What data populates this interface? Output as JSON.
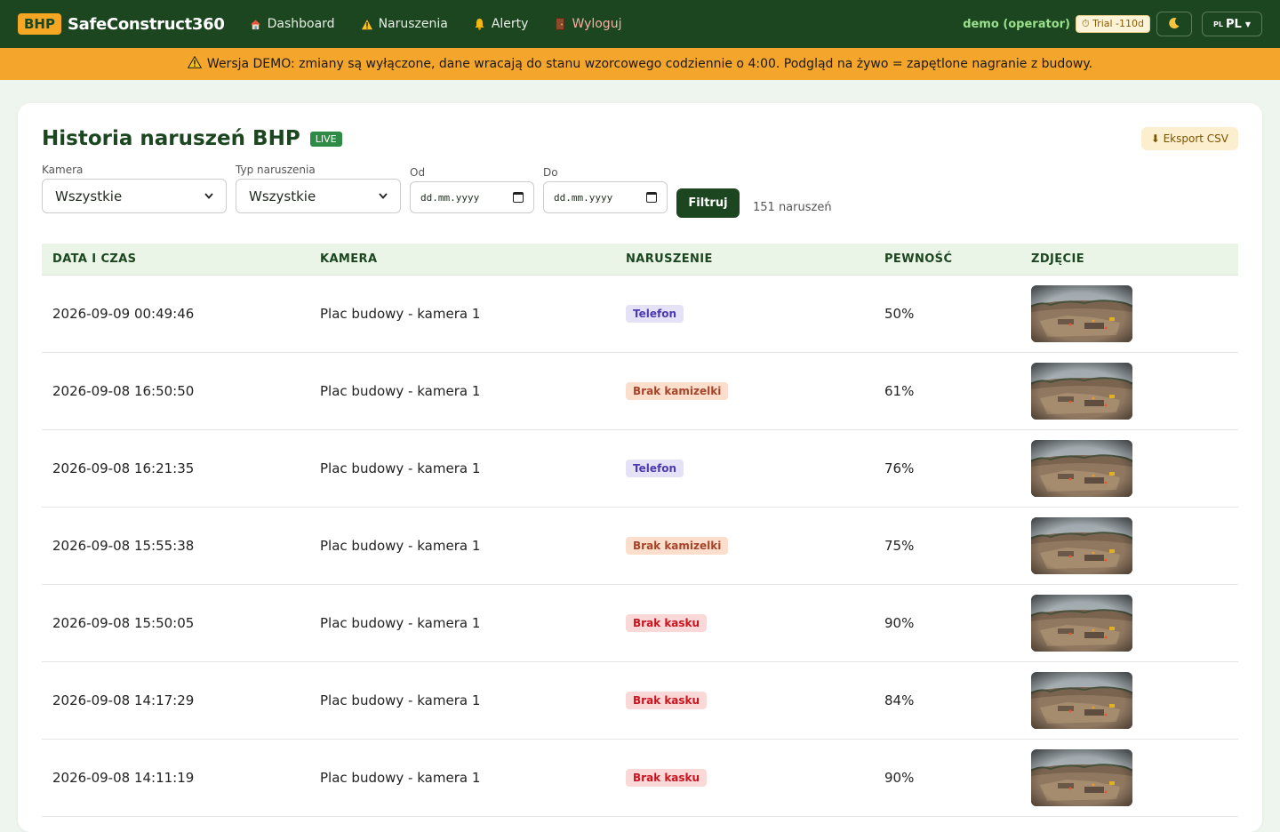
{
  "navbar": {
    "brand_badge": "BHP",
    "brand_name": "SafeConstruct360",
    "links": [
      {
        "label": "Dashboard",
        "icon": "house-icon"
      },
      {
        "label": "Naruszenia",
        "icon": "warning-icon"
      },
      {
        "label": "Alerty",
        "icon": "bell-icon"
      },
      {
        "label": "Wyloguj",
        "icon": "door-icon"
      }
    ],
    "user": "demo (operator)",
    "trial": "⏱ Trial -110d",
    "theme_icon": "moon-icon",
    "lang_flag": "PL",
    "lang_label": "PL"
  },
  "banner": {
    "text": "Wersja DEMO: zmiany są wyłączone, dane wracają do stanu wzorcowego codziennie o 4:00. Podgląd na żywo = zapętlone nagranie z budowy."
  },
  "page": {
    "title": "Historia naruszeń BHP",
    "live_badge": "LIVE",
    "export_label": "⬇ Eksport CSV"
  },
  "filters": {
    "camera_label": "Kamera",
    "camera_value": "Wszystkie",
    "type_label": "Typ naruszenia",
    "type_value": "Wszystkie",
    "from_label": "Od",
    "to_label": "Do",
    "date_placeholder": "dd.mm.yyyy",
    "filter_button": "Filtruj",
    "count": "151 naruszeń"
  },
  "table": {
    "headers": [
      "DATA I CZAS",
      "KAMERA",
      "NARUSZENIE",
      "PEWNOŚĆ",
      "ZDJĘCIE"
    ],
    "rows": [
      {
        "datetime": "2026-09-09 00:49:46",
        "camera": "Plac budowy - kamera 1",
        "violation": "Telefon",
        "kind": "phone",
        "confidence": "50%"
      },
      {
        "datetime": "2026-09-08 16:50:50",
        "camera": "Plac budowy - kamera 1",
        "violation": "Brak kamizelki",
        "kind": "vest",
        "confidence": "61%"
      },
      {
        "datetime": "2026-09-08 16:21:35",
        "camera": "Plac budowy - kamera 1",
        "violation": "Telefon",
        "kind": "phone",
        "confidence": "76%"
      },
      {
        "datetime": "2026-09-08 15:55:38",
        "camera": "Plac budowy - kamera 1",
        "violation": "Brak kamizelki",
        "kind": "vest",
        "confidence": "75%"
      },
      {
        "datetime": "2026-09-08 15:50:05",
        "camera": "Plac budowy - kamera 1",
        "violation": "Brak kasku",
        "kind": "helmet",
        "confidence": "90%"
      },
      {
        "datetime": "2026-09-08 14:17:29",
        "camera": "Plac budowy - kamera 1",
        "violation": "Brak kasku",
        "kind": "helmet",
        "confidence": "84%"
      },
      {
        "datetime": "2026-09-08 14:11:19",
        "camera": "Plac budowy - kamera 1",
        "violation": "Brak kasku",
        "kind": "helmet",
        "confidence": "90%"
      }
    ]
  },
  "colors": {
    "nav_bg": "#1c4620",
    "banner_bg": "#f4a52b",
    "accent_green": "#2e8b45"
  }
}
